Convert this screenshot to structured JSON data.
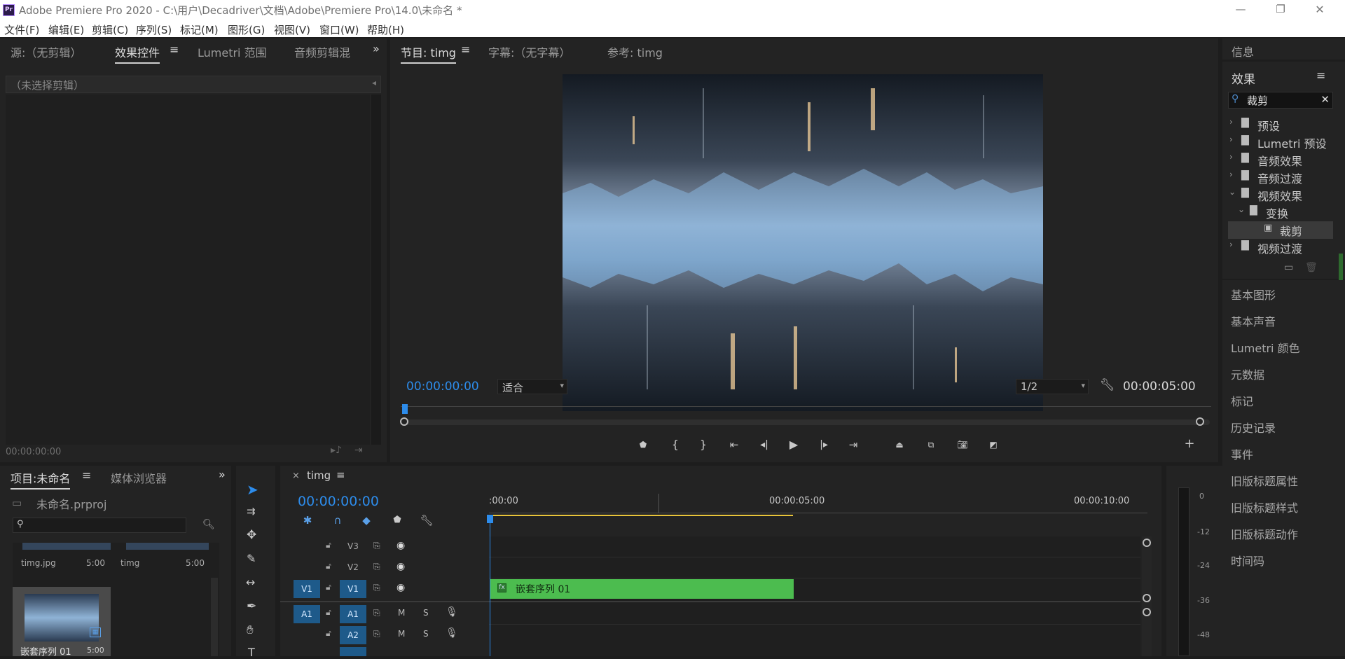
{
  "window": {
    "app_icon": "Pr",
    "title": "Adobe Premiere Pro 2020 - C:\\用户\\Decadriver\\文档\\Adobe\\Premiere Pro\\14.0\\未命名 *",
    "min": "—",
    "max": "❐",
    "close": "✕"
  },
  "menu": [
    "文件(F)",
    "编辑(E)",
    "剪辑(C)",
    "序列(S)",
    "标记(M)",
    "图形(G)",
    "视图(V)",
    "窗口(W)",
    "帮助(H)"
  ],
  "source_panel": {
    "tabs": [
      "源:（无剪辑）",
      "效果控件",
      "Lumetri 范围",
      "音频剪辑混"
    ],
    "active_tab": 1,
    "menu_glyph": "≡",
    "overflow": "»",
    "no_clip": "（未选择剪辑）",
    "timecode": "00:00:00:00"
  },
  "program_panel": {
    "tabs": [
      "节目: timg",
      "字幕:（无字幕）",
      "参考: timg"
    ],
    "menu_glyph": "≡",
    "timecode": "00:00:00:00",
    "fit": "适合",
    "resolution": "1/2",
    "duration": "00:00:05:00"
  },
  "project_panel": {
    "tabs": [
      "项目:未命名",
      "媒体浏览器"
    ],
    "menu_glyph": "≡",
    "overflow": "»",
    "project_file": "未命名.prproj",
    "items": [
      {
        "name": "timg.jpg",
        "duration": "5:00"
      },
      {
        "name": "timg",
        "duration": "5:00"
      },
      {
        "name": "嵌套序列 01",
        "duration": "5:00"
      }
    ]
  },
  "timeline": {
    "tab": "timg",
    "close": "×",
    "menu_glyph": "≡",
    "timecode": "00:00:00:00",
    "ruler": [
      ":00:00",
      "00:00:05:00",
      "00:00:10:00"
    ],
    "tracks_video": [
      "V3",
      "V2",
      "V1"
    ],
    "tracks_audio": [
      "A1",
      "A2"
    ],
    "source_v": "V1",
    "source_a": "A1",
    "mute": "M",
    "solo": "S",
    "clip": {
      "label": "嵌套序列 01",
      "color": "#4cbc4f"
    }
  },
  "meter": {
    "ticks": [
      "0",
      "-12",
      "-24",
      "-36",
      "-48"
    ]
  },
  "effects_panel": {
    "info": "信息",
    "title": "效果",
    "menu_glyph": "≡",
    "search_value": "裁剪",
    "clear": "✕",
    "tree": [
      {
        "label": "预设",
        "expanded": false,
        "level": 0
      },
      {
        "label": "Lumetri 预设",
        "expanded": false,
        "level": 0
      },
      {
        "label": "音频效果",
        "expanded": false,
        "level": 0
      },
      {
        "label": "音频过渡",
        "expanded": false,
        "level": 0
      },
      {
        "label": "视频效果",
        "expanded": true,
        "level": 0
      },
      {
        "label": "变换",
        "expanded": true,
        "level": 1
      },
      {
        "label": "裁剪",
        "expanded": false,
        "level": 2
      },
      {
        "label": "视频过渡",
        "expanded": false,
        "level": 0
      }
    ]
  },
  "side_panels": [
    "基本图形",
    "基本声音",
    "Lumetri 颜色",
    "元数据",
    "标记",
    "历史记录",
    "事件",
    "旧版标题属性",
    "旧版标题样式",
    "旧版标题动作",
    "时间码"
  ],
  "colors": {
    "accent_blue": "#2d8ceb",
    "playhead": "#2d8ceb",
    "clip_green": "#4cbc4f",
    "work_area": "#e8c43a"
  }
}
